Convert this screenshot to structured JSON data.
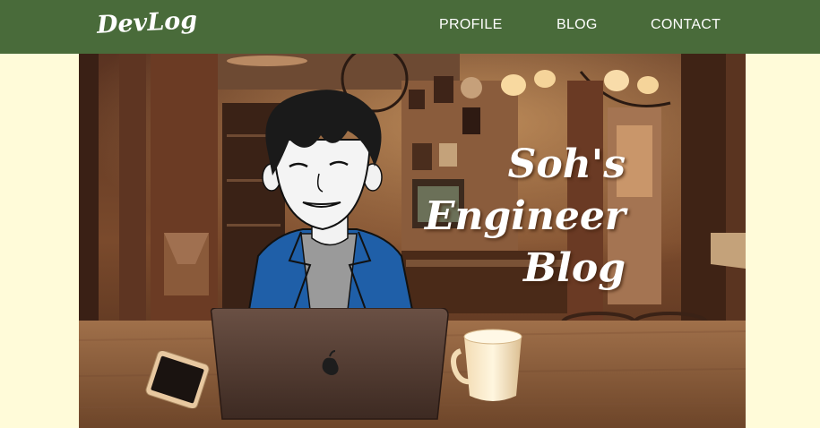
{
  "header": {
    "logo": "DevLog",
    "nav": [
      {
        "label": "PROFILE"
      },
      {
        "label": "BLOG"
      },
      {
        "label": "CONTACT"
      }
    ],
    "background_color": "#496b3a"
  },
  "hero": {
    "title_lines": [
      "Soh's",
      "Engineer",
      "Blog"
    ],
    "description_icons": [
      "cafe-background-image",
      "avatar-illustration",
      "laptop-icon",
      "smartphone-icon",
      "coffee-cup-icon"
    ]
  },
  "page": {
    "background_color": "#fffbd9"
  }
}
